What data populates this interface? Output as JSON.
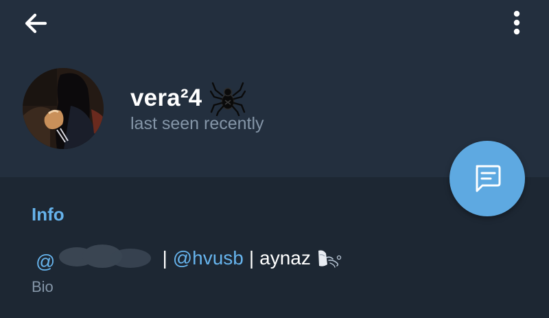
{
  "profile": {
    "name": "vera²4",
    "status": "last seen recently",
    "name_emoji": "spider-icon"
  },
  "info": {
    "section_title": "Info",
    "bio": {
      "at_prefix": "@",
      "separator_1": "|",
      "mention": "@hvusb",
      "separator_2": "|",
      "text": "aynaz",
      "emoji": "wind-face-icon",
      "label": "Bio"
    }
  },
  "colors": {
    "background": "#1d2733",
    "header": "#232f3e",
    "accent": "#66b3ec",
    "fab": "#5ea9e1",
    "secondary_text": "#8596a8"
  }
}
